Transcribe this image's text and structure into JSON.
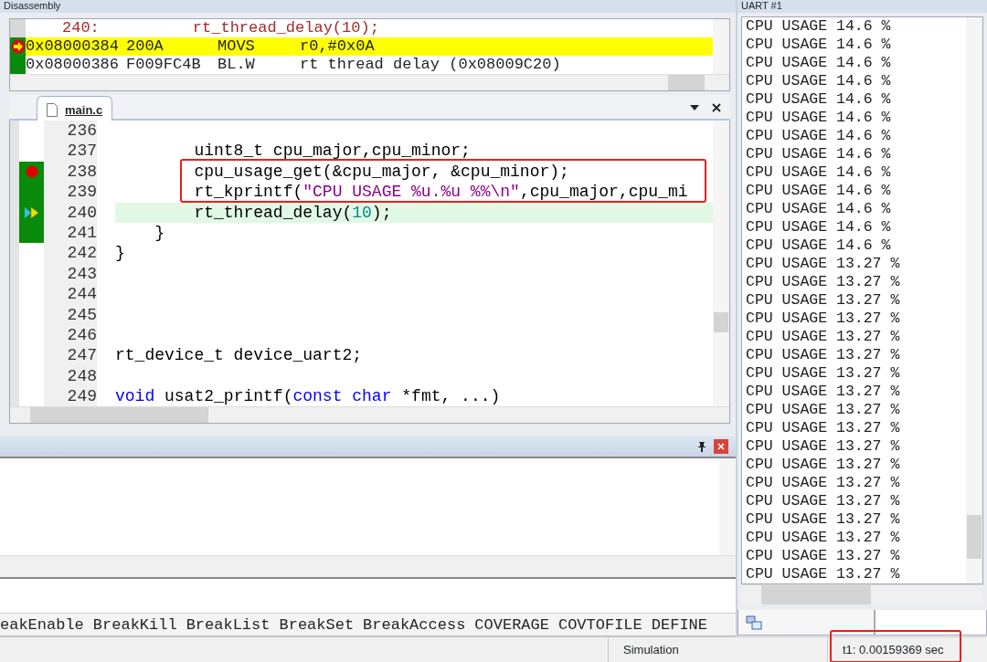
{
  "disassembly": {
    "title": "Disassembly",
    "rows": [
      {
        "kind": "source",
        "text": "240:          rt_thread_delay(10);",
        "current": false,
        "executed": false
      },
      {
        "kind": "instruction",
        "address": "0x08000384",
        "opcode": "200A",
        "mnemonic": "MOVS",
        "operands": "r0,#0x0A",
        "current": true,
        "executed": true
      },
      {
        "kind": "instruction",
        "address": "0x08000386",
        "opcode": "F009FC4B",
        "mnemonic": "BL.W",
        "operands": "rt thread delay (0x08009C20)",
        "current": false,
        "executed": true
      }
    ]
  },
  "editor": {
    "tab": {
      "label": "main.c",
      "selected": true
    },
    "lines": [
      {
        "number": "236",
        "executed": false,
        "breakpoint": false,
        "current": false
      },
      {
        "number": "237",
        "executed": false,
        "breakpoint": false,
        "current": false,
        "segments": [
          {
            "kind": "plain",
            "text": "        uint8_t cpu_major,cpu_minor;"
          }
        ]
      },
      {
        "number": "238",
        "executed": true,
        "breakpoint": true,
        "current": false,
        "segments": [
          {
            "kind": "plain",
            "text": "        cpu_usage_get(&cpu_major, &cpu_minor);"
          }
        ]
      },
      {
        "number": "239",
        "executed": true,
        "breakpoint": false,
        "current": false,
        "segments": [
          {
            "kind": "plain",
            "text": "        rt_kprintf("
          },
          {
            "kind": "string",
            "text": "\"CPU USAGE %u.%u %%\\n\""
          },
          {
            "kind": "plain",
            "text": ",cpu_major,cpu_mi"
          }
        ]
      },
      {
        "number": "240",
        "executed": true,
        "breakpoint": false,
        "current": true,
        "segments": [
          {
            "kind": "plain",
            "text": "        rt_thread_delay("
          },
          {
            "kind": "number",
            "text": "10"
          },
          {
            "kind": "plain",
            "text": ");"
          }
        ]
      },
      {
        "number": "241",
        "executed": true,
        "breakpoint": false,
        "current": false,
        "segments": [
          {
            "kind": "plain",
            "text": "    }"
          }
        ]
      },
      {
        "number": "242",
        "executed": false,
        "breakpoint": false,
        "current": false,
        "segments": [
          {
            "kind": "plain",
            "text": "}"
          }
        ]
      },
      {
        "number": "243",
        "executed": false,
        "breakpoint": false,
        "current": false
      },
      {
        "number": "244",
        "executed": false,
        "breakpoint": false,
        "current": false
      },
      {
        "number": "245",
        "executed": false,
        "breakpoint": false,
        "current": false
      },
      {
        "number": "246",
        "executed": false,
        "breakpoint": false,
        "current": false
      },
      {
        "number": "247",
        "executed": false,
        "breakpoint": false,
        "current": false,
        "segments": [
          {
            "kind": "plain",
            "text": "rt_device_t device_uart2;"
          }
        ]
      },
      {
        "number": "248",
        "executed": false,
        "breakpoint": false,
        "current": false
      },
      {
        "number": "249",
        "executed": false,
        "breakpoint": false,
        "current": false,
        "segments": [
          {
            "kind": "keyword",
            "text": "void"
          },
          {
            "kind": "plain",
            "text": " usat2_printf("
          },
          {
            "kind": "keyword",
            "text": "const char"
          },
          {
            "kind": "plain",
            "text": " *fmt, ...)"
          }
        ]
      }
    ]
  },
  "command_list": [
    "eakEnable",
    "BreakKill",
    "BreakList",
    "BreakSet",
    "BreakAccess",
    "COVERAGE",
    "COVTOFILE",
    "DEFINE"
  ],
  "uart": {
    "title": "UART #1",
    "lines": [
      "CPU USAGE 14.6 %",
      "CPU USAGE 14.6 %",
      "CPU USAGE 14.6 %",
      "CPU USAGE 14.6 %",
      "CPU USAGE 14.6 %",
      "CPU USAGE 14.6 %",
      "CPU USAGE 14.6 %",
      "CPU USAGE 14.6 %",
      "CPU USAGE 14.6 %",
      "CPU USAGE 14.6 %",
      "CPU USAGE 14.6 %",
      "CPU USAGE 14.6 %",
      "CPU USAGE 14.6 %",
      "CPU USAGE 13.27 %",
      "CPU USAGE 13.27 %",
      "CPU USAGE 13.27 %",
      "CPU USAGE 13.27 %",
      "CPU USAGE 13.27 %",
      "CPU USAGE 13.27 %",
      "CPU USAGE 13.27 %",
      "CPU USAGE 13.27 %",
      "CPU USAGE 13.27 %",
      "CPU USAGE 13.27 %",
      "CPU USAGE 13.27 %",
      "CPU USAGE 13.27 %",
      "CPU USAGE 13.27 %",
      "CPU USAGE 13.27 %",
      "CPU USAGE 13.27 %",
      "CPU USAGE 13.27 %",
      "CPU USAGE 13.27 %",
      "CPU USAGE 13.27 %"
    ]
  },
  "status_bar": {
    "mode": "Simulation",
    "time": "t1: 0.00159369 sec"
  }
}
